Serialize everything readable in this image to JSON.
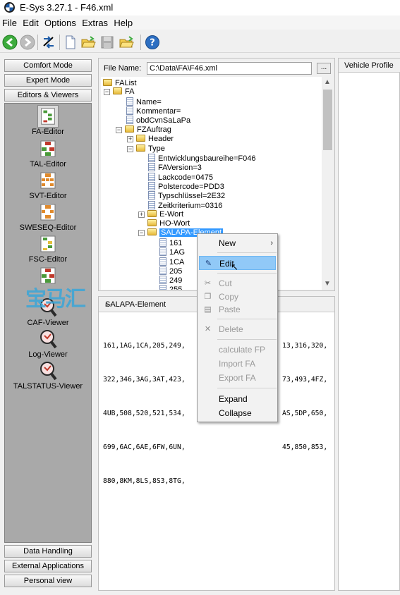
{
  "window": {
    "title": "E-Sys 3.27.1 - F46.xml"
  },
  "menubar": [
    "File",
    "Edit",
    "Options",
    "Extras",
    "Help"
  ],
  "left_panel": {
    "top_buttons": [
      "Comfort Mode",
      "Expert Mode",
      "Editors & Viewers"
    ],
    "tools": [
      "FA-Editor",
      "TAL-Editor",
      "SVT-Editor",
      "SWESEQ-Editor",
      "FSC-Editor",
      "FP-Editor",
      "CAF-Viewer",
      "Log-Viewer",
      "TALSTATUS-Viewer"
    ],
    "bottom_buttons": [
      "Data Handling",
      "External Applications",
      "Personal view"
    ]
  },
  "file": {
    "label": "File Name:",
    "value": "C:\\Data\\FA\\F46.xml",
    "browse": "..."
  },
  "tree": [
    "FAList",
    "FA",
    "Name=",
    "Kommentar=",
    "obdCvnSaLaPa",
    "FZAuftrag",
    "Header",
    "Type",
    "Entwicklungsbaureihe=F046",
    "FAVersion=3",
    "Lackcode=0475",
    "Polstercode=PDD3",
    "Typschlüssel=2E32",
    "Zeitkriterium=0316",
    "E-Wort",
    "HO-Wort",
    "SALAPA-Element",
    "161",
    "1AG",
    "1CA",
    "205",
    "249",
    "255"
  ],
  "vehicle_profile": {
    "title": "Vehicle Profile"
  },
  "detail": {
    "title": "SALAPA-Element",
    "lines": [
      "161,1AG,1CA,205,249,",
      "322,346,3AG,3AT,423,",
      "4UB,508,520,521,534,",
      "699,6AC,6AE,6FW,6UN,",
      "880,8KM,8LS,8S3,8TG,"
    ],
    "lines_right": [
      "13,316,320,",
      "73,493,4FZ,",
      "AS,5DP,650,",
      "45,850,853,",
      ""
    ]
  },
  "context_menu": {
    "new": "New",
    "edit": "Edit",
    "cut": "Cut",
    "copy": "Copy",
    "paste": "Paste",
    "delete": "Delete",
    "calculate": "calculate FP",
    "import": "Import FA",
    "export": "Export FA",
    "expand": "Expand",
    "collapse": "Collapse"
  },
  "watermark": "宝马汇"
}
